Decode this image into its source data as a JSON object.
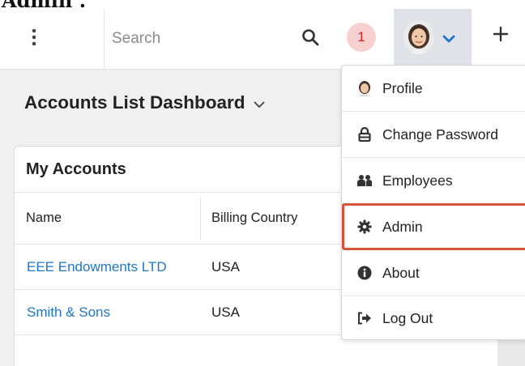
{
  "header": {
    "clipped_title": "Admin .",
    "search_placeholder": "Search",
    "notification_count": "1"
  },
  "dashboard": {
    "title": "Accounts List Dashboard"
  },
  "card": {
    "title": "My Accounts",
    "columns": [
      "Name",
      "Billing Country"
    ],
    "rows": [
      {
        "name": "EEE Endowments LTD",
        "country": "USA"
      },
      {
        "name": "Smith & Sons",
        "country": "USA"
      }
    ]
  },
  "user_menu": {
    "items": [
      {
        "label": "Profile",
        "icon": "profile-avatar-icon"
      },
      {
        "label": "Change Password",
        "icon": "lock-icon"
      },
      {
        "label": "Employees",
        "icon": "employees-icon"
      },
      {
        "label": "Admin",
        "icon": "gear-icon",
        "highlighted": true
      },
      {
        "label": "About",
        "icon": "info-icon"
      },
      {
        "label": "Log Out",
        "icon": "logout-icon"
      }
    ]
  },
  "colors": {
    "link": "#1f76c9",
    "highlight_border": "#d9533a",
    "notification_bg": "#f9d0d0",
    "notification_text": "#dd2222",
    "user_button_bg": "#dfe3e7"
  }
}
